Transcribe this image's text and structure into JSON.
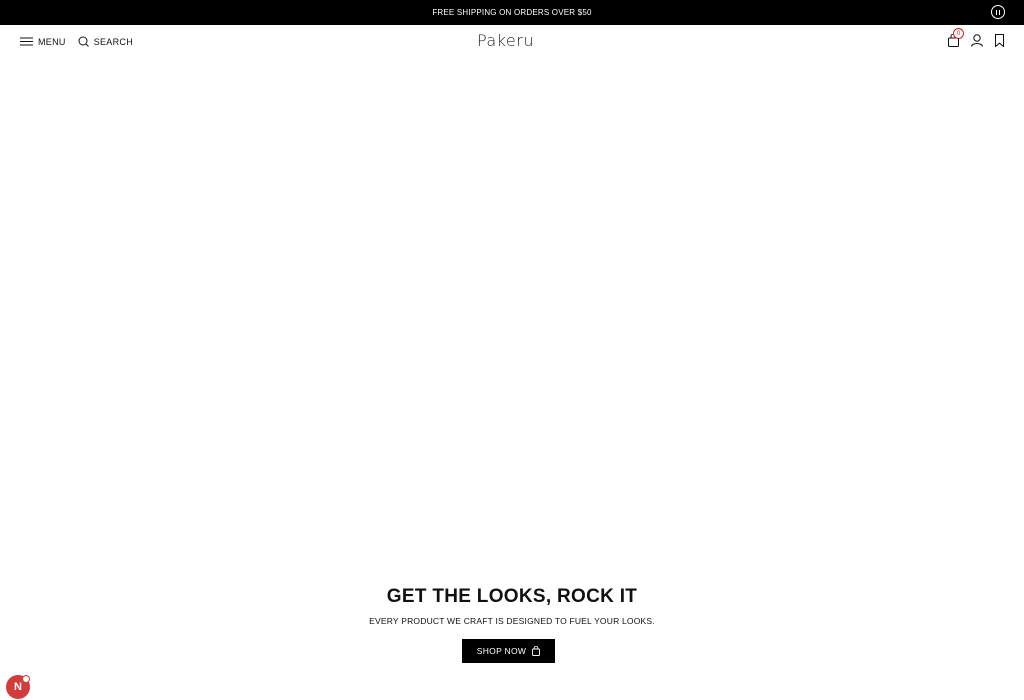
{
  "announcement": {
    "text": "FREE SHIPPING ON ORDERS OVER $50"
  },
  "header": {
    "menu_label": "MENU",
    "search_label": "SEARCH",
    "logo_text": "Pakeru",
    "cart_count": "0",
    "icons": [
      "menu-icon",
      "search-icon",
      "bag-icon",
      "account-icon",
      "bookmark-icon"
    ]
  },
  "hero": {
    "title": "GET THE LOOKS, ROCK IT",
    "subtitle": "EVERY PRODUCT WE CRAFT IS DESIGNED TO FUEL YOUR LOOKS.",
    "button_label": "SHOP NOW"
  },
  "floating_widget": {
    "label": "N"
  },
  "colors": {
    "announcement_bg": "#000000",
    "button_bg": "#000000",
    "badge": "#d02020",
    "widget": "#d23c3c"
  }
}
